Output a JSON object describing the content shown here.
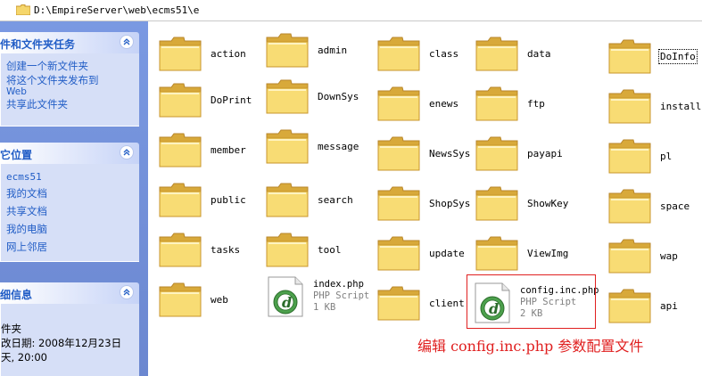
{
  "address": {
    "path": "D:\\EmpireServer\\web\\ecms51\\e"
  },
  "pane": {
    "tasks": {
      "title": "件和文件夹任务",
      "items": [
        "创建一个新文件夹",
        "将这个文件夹发布到",
        "Web",
        "共享此文件夹"
      ]
    },
    "places": {
      "title": "它位置",
      "items": [
        "ecms51",
        "我的文档",
        "共享文档",
        "我的电脑",
        "网上邻居"
      ]
    },
    "details": {
      "title": "细信息",
      "lines": [
        "件夹",
        "改日期: 2008年12月23日",
        "天, 20:00"
      ]
    }
  },
  "folders": [
    {
      "name": "action"
    },
    {
      "name": "admin"
    },
    {
      "name": "class"
    },
    {
      "name": "data"
    },
    {
      "name": "DoInfo"
    },
    {
      "name": "DoPrint"
    },
    {
      "name": "DownSys"
    },
    {
      "name": "enews"
    },
    {
      "name": "ftp"
    },
    {
      "name": "install"
    },
    {
      "name": "member"
    },
    {
      "name": "message"
    },
    {
      "name": "NewsSys"
    },
    {
      "name": "payapi"
    },
    {
      "name": "pl"
    },
    {
      "name": "public"
    },
    {
      "name": "search"
    },
    {
      "name": "ShopSys"
    },
    {
      "name": "ShowKey"
    },
    {
      "name": "space"
    },
    {
      "name": "tasks"
    },
    {
      "name": "tool"
    },
    {
      "name": "update"
    },
    {
      "name": "ViewImg"
    },
    {
      "name": "wap"
    },
    {
      "name": "web"
    },
    {
      "name": "client"
    },
    {
      "name": "api"
    }
  ],
  "files": [
    {
      "name": "index.php",
      "type": "PHP Script",
      "size": "1 KB"
    },
    {
      "name": "config.inc.php",
      "type": "PHP Script",
      "size": "2 KB"
    }
  ],
  "annotation": "编辑 config.inc.php 参数配置文件",
  "colors": {
    "folder": "#f5d66b",
    "folderDark": "#d8a93a",
    "annotation": "#e02020",
    "pane": "#7491d7",
    "link": "#215dc6"
  }
}
